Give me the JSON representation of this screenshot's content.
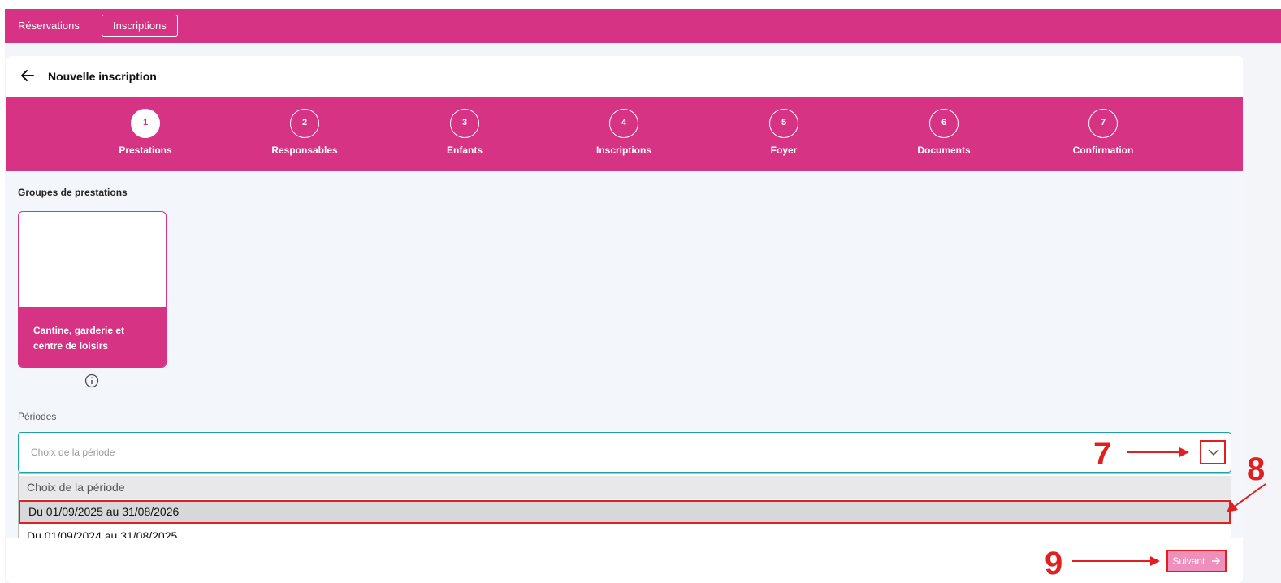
{
  "nav": {
    "items": [
      {
        "label": "Réservations",
        "active": false
      },
      {
        "label": "Inscriptions",
        "active": true
      }
    ]
  },
  "page": {
    "title": "Nouvelle inscription",
    "back_icon": "arrow-left-icon"
  },
  "stepper": {
    "steps": [
      {
        "number": "1",
        "label": "Prestations",
        "active": true
      },
      {
        "number": "2",
        "label": "Responsables",
        "active": false
      },
      {
        "number": "3",
        "label": "Enfants",
        "active": false
      },
      {
        "number": "4",
        "label": "Inscriptions",
        "active": false
      },
      {
        "number": "5",
        "label": "Foyer",
        "active": false
      },
      {
        "number": "6",
        "label": "Documents",
        "active": false
      },
      {
        "number": "7",
        "label": "Confirmation",
        "active": false
      }
    ]
  },
  "groups": {
    "label": "Groupes de prestations",
    "items": [
      {
        "title": "Cantine, garderie et centre de loisirs",
        "info_icon": "info-circle-icon"
      }
    ]
  },
  "periods": {
    "label": "Périodes",
    "placeholder": "Choix de la période",
    "dropdown_icon": "chevron-down-icon",
    "options": [
      {
        "label": "Choix de la période",
        "placeholder": true
      },
      {
        "label": "Du 01/09/2025 au 31/08/2026",
        "highlighted": true
      },
      {
        "label": "Du 01/09/2024 au 31/08/2025",
        "highlighted": false
      }
    ]
  },
  "footer": {
    "next_label": "Suivant",
    "next_icon": "arrow-right-icon"
  },
  "annotations": {
    "markers": [
      "7",
      "8",
      "9"
    ],
    "color": "#e02020"
  },
  "colors": {
    "brand": "#d63384",
    "focus_border": "#1da1a8",
    "annotation": "#e02020"
  }
}
